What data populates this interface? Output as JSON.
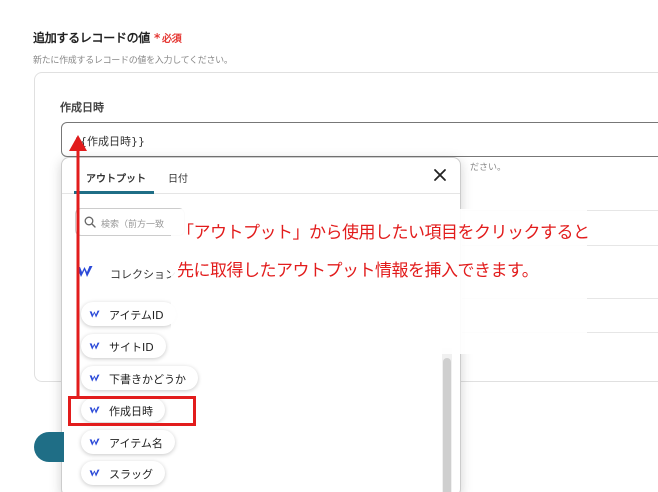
{
  "section": {
    "title": "追加するレコードの値",
    "required_star": "*",
    "required_text": "必須",
    "description": "新たに作成するレコードの値を入力してください。"
  },
  "field": {
    "label": "作成日時",
    "value": "{{作成日時}}"
  },
  "hint_right": "ださい。",
  "dropdown": {
    "tabs": [
      {
        "label": "アウトプット"
      },
      {
        "label": "日付"
      }
    ],
    "search_placeholder": "検索（前方一致",
    "collection_label": "コレクション",
    "items": [
      {
        "label": "アイテムID"
      },
      {
        "label": "サイトID"
      },
      {
        "label": "下書きかどうか"
      },
      {
        "label": "作成日時"
      },
      {
        "label": "アイテム名"
      },
      {
        "label": "スラッグ"
      }
    ]
  },
  "callout": {
    "line1": "「アウトプット」から使用したい項目をクリックすると",
    "line2": "先に取得したアウトプット情報を挿入できます。"
  },
  "colors": {
    "accent": "#1f6e86",
    "annotation": "#e21c1c",
    "required": "#e53935"
  },
  "icons": [
    "close-icon",
    "search-icon",
    "webflow-icon",
    "arrow-up-icon"
  ]
}
